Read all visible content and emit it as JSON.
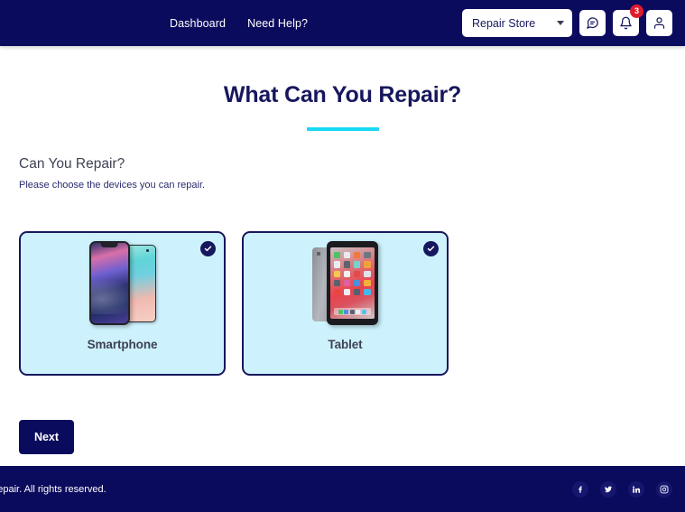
{
  "header": {
    "nav": [
      {
        "label": "Dashboard",
        "name": "nav-link-dashboard"
      },
      {
        "label": "Need Help?",
        "name": "nav-link-need-help"
      }
    ],
    "store_selector": {
      "value": "Repair Store",
      "icon": "chevron-down-icon"
    },
    "actions": [
      {
        "name": "chat-icon",
        "label": "chat"
      },
      {
        "name": "bell-icon",
        "label": "notifications",
        "badge": "3"
      },
      {
        "name": "user-icon",
        "label": "account"
      }
    ],
    "notification_count": "3"
  },
  "main": {
    "page_title": "What Can You Repair?",
    "section_heading": "Can You Repair?",
    "section_subtitle": "Please choose the devices you can repair.",
    "cards": [
      {
        "label": "Smartphone",
        "name": "device-card-smartphone",
        "selected": true,
        "art": "smartphone-image"
      },
      {
        "label": "Tablet",
        "name": "device-card-tablet",
        "selected": true,
        "art": "tablet-image"
      }
    ],
    "next_button": "Next"
  },
  "footer": {
    "copyright": "Your Repair. All rights reserved.",
    "socials": [
      {
        "name": "facebook-icon",
        "label": "Facebook"
      },
      {
        "name": "twitter-icon",
        "label": "Twitter"
      },
      {
        "name": "linkedin-icon",
        "label": "LinkedIn"
      },
      {
        "name": "instagram-icon",
        "label": "Instagram"
      }
    ]
  },
  "colors": {
    "brand_navy": "#0b0b5e",
    "accent_cyan": "#1ad9f5",
    "card_fill": "#cdf2fd",
    "badge_red": "#e01b2e",
    "text_slate": "#3f4254"
  },
  "tablet_apps": [
    "#4cc464",
    "#e7eaef",
    "#f07a3c",
    "#6f7781",
    "#e9edf2",
    "#5b6470",
    "#79d3ce",
    "#f2a23c",
    "#f6c84c",
    "#eef1f5",
    "#e04b4b",
    "#dfe4ea",
    "#596270",
    "#e05fa5",
    "#4a90e2",
    "#f2b13c",
    "#e8463f",
    "#eaeef3",
    "#54606e",
    "#48b7e8"
  ],
  "tablet_dock": [
    "#4cc464",
    "#4a90e2",
    "#596270",
    "#e8eef3",
    "#55c0e8"
  ]
}
